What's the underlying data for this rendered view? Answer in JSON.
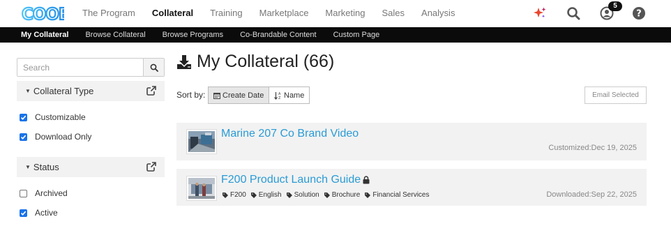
{
  "header": {
    "logo_text": "COOE",
    "nav": [
      "The Program",
      "Collateral",
      "Training",
      "Marketplace",
      "Marketing",
      "Sales",
      "Analysis"
    ],
    "active_nav": "Collateral",
    "notification_count": "5",
    "icons": [
      "sparkle-icon",
      "search-icon",
      "user-icon",
      "help-icon"
    ],
    "sparkle_color": "#e8462f"
  },
  "subnav": {
    "items": [
      "My Collateral",
      "Browse Collateral",
      "Browse Programs",
      "Co-Brandable Content",
      "Custom Page"
    ],
    "active": "My Collateral"
  },
  "sidebar": {
    "search_placeholder": "Search",
    "facets": [
      {
        "title": "Collateral Type",
        "options": [
          {
            "label": "Customizable",
            "checked": true
          },
          {
            "label": "Download Only",
            "checked": true
          }
        ]
      },
      {
        "title": "Status",
        "options": [
          {
            "label": "Archived",
            "checked": false
          },
          {
            "label": "Active",
            "checked": true
          }
        ]
      }
    ]
  },
  "main": {
    "title": "My Collateral (66)",
    "sort_label": "Sort by:",
    "sort_options": [
      {
        "label": "Create Date",
        "active": true
      },
      {
        "label": "Name",
        "active": false
      }
    ],
    "email_selected_label": "Email Selected",
    "items": [
      {
        "title": "Marine 207 Co Brand Video",
        "locked": false,
        "tags": [],
        "status": "Customized:Dec 19, 2025"
      },
      {
        "title": "F200 Product Launch Guide",
        "locked": true,
        "tags": [
          "F200",
          "English",
          "Solution",
          "Brochure",
          "Financial Services"
        ],
        "status": "Downloaded:Sep 22, 2025"
      }
    ]
  },
  "colors": {
    "link": "#2a9bd6",
    "subnav_bg": "#0b0b0b",
    "checkbox": "#1a73e8",
    "panel_bg": "#f2f2f2"
  }
}
